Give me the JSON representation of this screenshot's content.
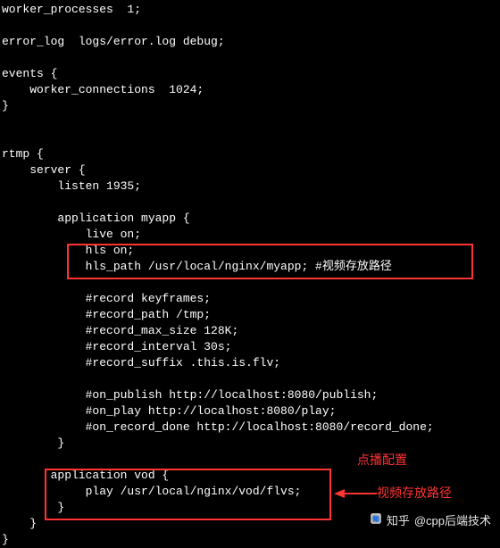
{
  "config": {
    "l01": "worker_processes  1;",
    "l02": "",
    "l03": "error_log  logs/error.log debug;",
    "l04": "",
    "l05": "events {",
    "l06": "    worker_connections  1024;",
    "l07": "}",
    "l08": "",
    "l09": "",
    "l10": "rtmp {",
    "l11": "    server {",
    "l12": "        listen 1935;",
    "l13": "",
    "l14": "        application myapp {",
    "l15": "            live on;",
    "l16": "            hls on;",
    "l17": "            hls_path /usr/local/nginx/myapp; #视频存放路径",
    "l18": "",
    "l19": "            #record keyframes;",
    "l20": "            #record_path /tmp;",
    "l21": "            #record_max_size 128K;",
    "l22": "            #record_interval 30s;",
    "l23": "            #record_suffix .this.is.flv;",
    "l24": "",
    "l25": "            #on_publish http://localhost:8080/publish;",
    "l26": "            #on_play http://localhost:8080/play;",
    "l27": "            #on_record_done http://localhost:8080/record_done;",
    "l28": "        }",
    "l29": "",
    "l30": "       application vod {",
    "l31": "            play /usr/local/nginx/vod/flvs;",
    "l32": "        }",
    "l33": "    }",
    "l34": "}"
  },
  "callouts": {
    "a": "点播配置",
    "b": "视频存放路径"
  },
  "watermark": {
    "brand": "知乎",
    "text": "@cpp后端技术"
  }
}
